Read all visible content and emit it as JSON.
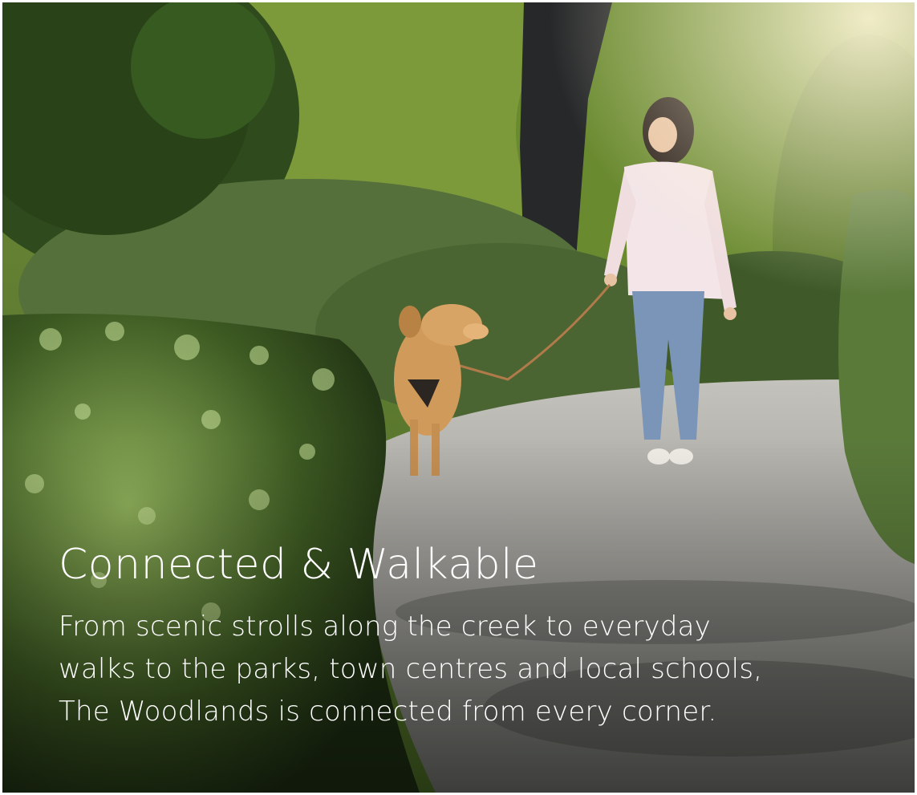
{
  "hero": {
    "image_description": "",
    "headline": "Connected & Walkable",
    "body_lines": [
      "From scenic strolls along the creek to everyday",
      "walks to the parks, town centres and local schools,",
      "The Woodlands is connected from every corner."
    ]
  },
  "colors": {
    "text": "#ffffff",
    "foliage": "#4d6b2c",
    "path": "#a9a9a4"
  }
}
